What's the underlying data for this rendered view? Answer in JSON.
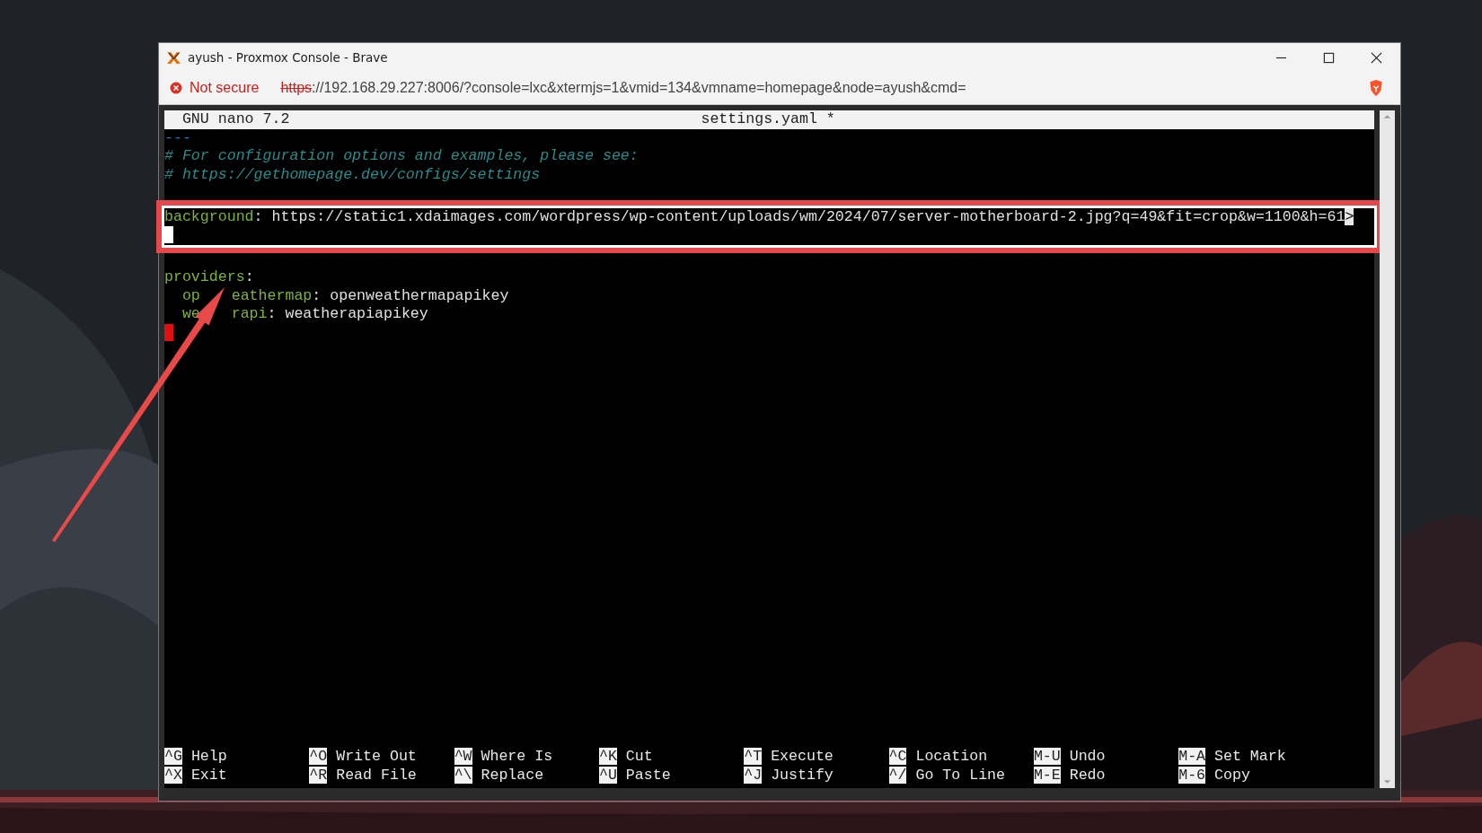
{
  "window": {
    "title": "ayush - Proxmox Console - Brave"
  },
  "address_bar": {
    "security": "Not secure",
    "scheme": "https",
    "url_rest": "://192.168.29.227:8006/?console=lxc&xtermjs=1&vmid=134&vmname=homepage&node=ayush&cmd="
  },
  "nano": {
    "version": "GNU nano 7.2",
    "filename": "settings.yaml *",
    "blocks": [
      {
        "highlighted": false,
        "lines": [
          {
            "kind": "text",
            "segments": [
              {
                "kind": "marker",
                "text": "---"
              }
            ]
          },
          {
            "kind": "text",
            "segments": [
              {
                "kind": "comment",
                "text": "# For configuration options and examples, please see:"
              }
            ]
          },
          {
            "kind": "text",
            "segments": [
              {
                "kind": "comment",
                "text": "# https://gethomepage.dev/configs/settings"
              }
            ]
          },
          {
            "kind": "blank"
          }
        ]
      },
      {
        "highlighted": true,
        "lines": [
          {
            "kind": "text",
            "segments": [
              {
                "kind": "key",
                "text": "background"
              },
              {
                "kind": "plain",
                "text": ": https://static1.xdaimages.com/wordpress/wp-content/uploads/wm/2024/07/server-motherboard-2.jpg?q=49&fit=crop&w=1100&h=61"
              },
              {
                "kind": "overflow",
                "text": ">"
              }
            ]
          },
          {
            "kind": "text",
            "segments": [
              {
                "kind": "cursor"
              }
            ]
          }
        ]
      },
      {
        "highlighted": false,
        "lines": [
          {
            "kind": "blank"
          },
          {
            "kind": "text",
            "segments": [
              {
                "kind": "key",
                "text": "providers"
              },
              {
                "kind": "plain",
                "text": ":"
              }
            ]
          },
          {
            "kind": "text",
            "segments": [
              {
                "kind": "indent"
              },
              {
                "kind": "key",
                "text": "op"
              },
              {
                "kind": "covered"
              },
              {
                "kind": "key",
                "text": "eathermap"
              },
              {
                "kind": "plain",
                "text": ": openweathermapapikey"
              }
            ]
          },
          {
            "kind": "text",
            "segments": [
              {
                "kind": "indent"
              },
              {
                "kind": "key",
                "text": "we"
              },
              {
                "kind": "covered"
              },
              {
                "kind": "key",
                "text": "rapi"
              },
              {
                "kind": "plain",
                "text": ": weatherapiapikey"
              }
            ]
          },
          {
            "kind": "text",
            "segments": [
              {
                "kind": "error"
              }
            ]
          }
        ]
      }
    ],
    "shortcuts": [
      {
        "top": {
          "key": "^G",
          "label": "Help"
        },
        "bottom": {
          "key": "^X",
          "label": "Exit"
        }
      },
      {
        "top": {
          "key": "^O",
          "label": "Write Out"
        },
        "bottom": {
          "key": "^R",
          "label": "Read File"
        }
      },
      {
        "top": {
          "key": "^W",
          "label": "Where Is"
        },
        "bottom": {
          "key": "^\\",
          "label": "Replace"
        }
      },
      {
        "top": {
          "key": "^K",
          "label": "Cut"
        },
        "bottom": {
          "key": "^U",
          "label": "Paste"
        }
      },
      {
        "top": {
          "key": "^T",
          "label": "Execute"
        },
        "bottom": {
          "key": "^J",
          "label": "Justify"
        }
      },
      {
        "top": {
          "key": "^C",
          "label": "Location"
        },
        "bottom": {
          "key": "^/",
          "label": "Go To Line"
        }
      },
      {
        "top": {
          "key": "M-U",
          "label": "Undo"
        },
        "bottom": {
          "key": "M-E",
          "label": "Redo"
        }
      },
      {
        "top": {
          "key": "M-A",
          "label": "Set Mark"
        },
        "bottom": {
          "key": "M-6",
          "label": "Copy"
        }
      }
    ]
  }
}
